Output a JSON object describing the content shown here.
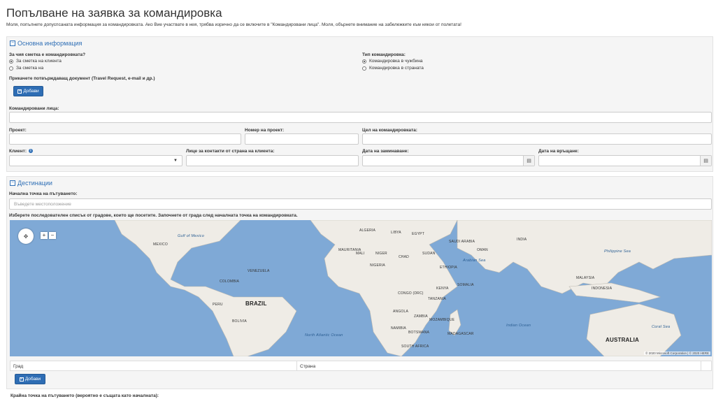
{
  "page": {
    "title": "Попълване на заявка за командировка",
    "subtitle": "Моля, попълнете допуспсаната информация за командировката. Ако Вие участвате в нея, трябва изрично да се включите в \"Командировани лица\". Моля, обърнете внимание на забележките към някои от полетата!"
  },
  "basic": {
    "heading": "Основна информация",
    "account_label": "За чия сметка е командировката?",
    "account_options": [
      "За сметка на клиента",
      "За сметка на"
    ],
    "account_selected": "За сметка на клиента",
    "trip_type_label": "Тип командировка:",
    "trip_type_options": [
      "Командировка в чужбина",
      "Командировка в страната"
    ],
    "trip_type_selected": "Командировка в чужбина",
    "attach_label": "Прикачете потвърждаващ документ (Travel Request, e-mail и др.)",
    "add_button": "Добави",
    "persons_label": "Командировани лица:",
    "project_label": "Проект:",
    "project_number_label": "Номер на проект:",
    "purpose_label": "Цел на командировката:",
    "client_label": "Клиент:",
    "contact_label": "Лице за контакти от страна на клиента:",
    "departure_label": "Дата на заминаване:",
    "return_label": "Дата на връщане:"
  },
  "destinations": {
    "heading": "Дестинации",
    "start_label": "Начална точка на пътуването:",
    "start_placeholder": "Въведете местоположение",
    "cities_hint": "Изберете последователен списък от градове, които ще посетите. Започнете от града след началната точка на командировката.",
    "map_copyright": "© 2020 Microsoft Corporation | © 2020 HERE",
    "map_labels": {
      "brazil": "BRAZIL",
      "australia": "AUSTRALIA",
      "north_atlantic": "North Atlantic Ocean",
      "indian": "Indian Ocean",
      "arabian": "Arabian Sea",
      "philippine": "Philippine Sea",
      "coral": "Coral Sea",
      "mexico": "MEXICO",
      "gulf": "Gulf of Mexico",
      "colombia": "COLOMBIA",
      "venezuela": "VENEZUELA",
      "peru": "PERU",
      "bolivia": "BOLIVIA",
      "algeria": "ALGERIA",
      "libya": "LIBYA",
      "egypt": "EGYPT",
      "mali": "MALI",
      "niger": "NIGER",
      "chad": "CHAD",
      "sudan": "SUDAN",
      "nigeria": "NIGERIA",
      "ethiopia": "ETHIOPIA",
      "kenya": "KENYA",
      "tanzania": "TANZANIA",
      "angola": "ANGOLA",
      "namibia": "NAMIBIA",
      "mozambique": "MOZAMBIQUE",
      "saudi": "SAUDI ARABIA",
      "india": "INDIA",
      "indonesia": "INDONESIA",
      "congo": "CONGO (DRC)",
      "zambia": "ZAMBIA",
      "botswana": "BOTSWANA",
      "south_africa": "SOUTH AFRICA",
      "mauritania": "MAURITANIA",
      "somalia": "SOMALIA",
      "madagascar": "MADAGASCAR",
      "oman": "OMAN",
      "malaysia": "MALAYSIA"
    },
    "table_headers": [
      "Град",
      "Страна"
    ],
    "add_button": "Добави",
    "end_label": "Крайна точка на пътуването (вероятно е същата като началната):"
  }
}
